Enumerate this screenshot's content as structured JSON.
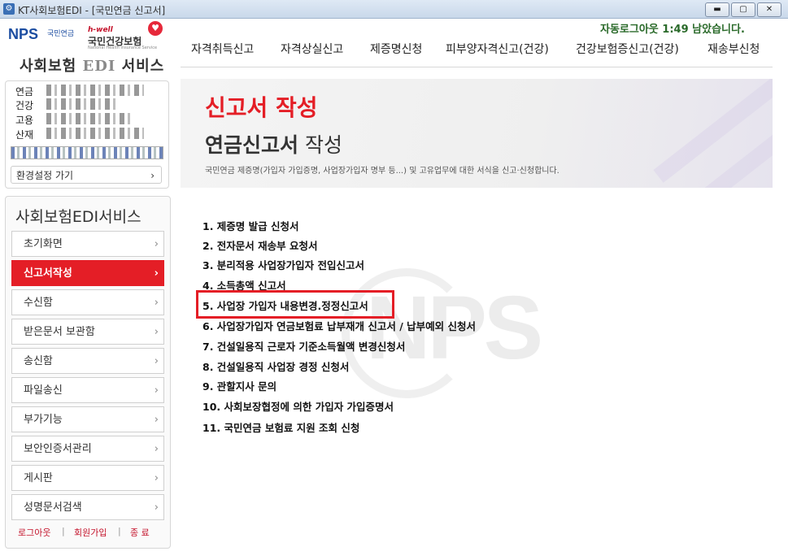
{
  "window": {
    "title": "KT사회보험EDI - [국민연금 신고서]",
    "minimize": "▬",
    "maximize": "▢",
    "close": "✕",
    "app_icon": "⚙"
  },
  "logo": {
    "nps": "NPS",
    "nps_sub": "국민연금",
    "hwell": "h-well",
    "nhis": "국민건강보험",
    "nhis_sub": "National Health Insurance Service",
    "heart": "♥",
    "service_prefix": "사회보험",
    "service_edi": "EDI",
    "service_suffix": "서비스"
  },
  "header": {
    "autologout": "자동로그아웃 1:49 남았습니다.",
    "nav": [
      "자격취득신고",
      "자격상실신고",
      "제증명신청",
      "피부양자격신고(건강)",
      "건강보험증신고(건강)",
      "재송부신청"
    ]
  },
  "userbox": {
    "rows": [
      "연금",
      "건강",
      "고용",
      "산재"
    ],
    "settings": "환경설정 가기",
    "chevron": "›"
  },
  "sidemenu": {
    "title": "사회보험EDI서비스",
    "items": [
      {
        "label": "초기화면",
        "active": false
      },
      {
        "label": "신고서작성",
        "active": true
      },
      {
        "label": "수신함",
        "active": false
      },
      {
        "label": "받은문서 보관함",
        "active": false
      },
      {
        "label": "송신함",
        "active": false
      },
      {
        "label": "파일송신",
        "active": false
      },
      {
        "label": "부가기능",
        "active": false
      },
      {
        "label": "보안인증서관리",
        "active": false
      },
      {
        "label": "게시판",
        "active": false
      },
      {
        "label": "성명문서검색",
        "active": false
      }
    ],
    "chevron": "›",
    "footer": {
      "logout": "로그아웃",
      "join": "회원가입",
      "exit": "종  료",
      "sep": "|"
    }
  },
  "banner": {
    "head": "신고서 작성",
    "sub_bold": "연금신고서",
    "sub_rest": " 작성",
    "desc": "국민연금 제증명(가입자 가입증명, 사업장가입자 명부 등...) 및 고유업무에 대한 서식을 신고·신청합니다."
  },
  "watermark": "NPS",
  "documents": [
    "1. 제증명 발급 신청서",
    "2. 전자문서 재송부 요청서",
    "3. 분리적용 사업장가입자 전입신고서",
    "4. 소득총액 신고서",
    "5. 사업장 가입자 내용변경.정정신고서",
    "6. 사업장가입자 연금보험료 납부재개 신고서 / 납부예외 신청서",
    "7. 건설일용직 근로자 기준소득월액 변경신청서",
    "8. 건설일용직 사업장 경정 신청서",
    "9. 관할지사 문의",
    "10. 사회보장협정에 의한 가입자 가입증명서",
    "11. 국민연금 보험료 지원 조회 신청"
  ],
  "colors": {
    "accent": "#e41e26",
    "nav_text": "#222222",
    "autologout": "#2a6a2a"
  }
}
